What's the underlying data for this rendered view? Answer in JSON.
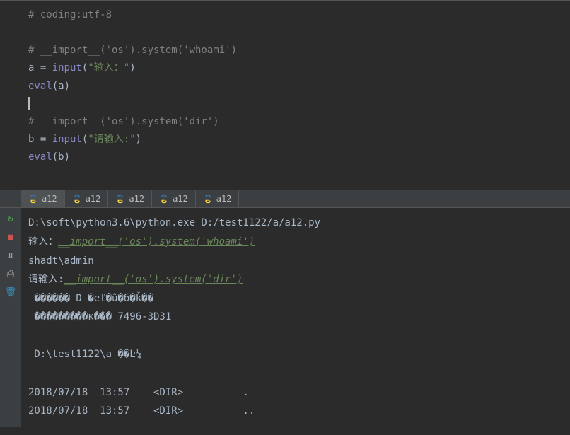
{
  "editor": {
    "lines": [
      {
        "type": "comment",
        "text": "# coding:utf-8"
      },
      {
        "type": "blank",
        "text": ""
      },
      {
        "type": "comment",
        "text": "# __import__('os').system('whoami')"
      },
      {
        "type": "assign",
        "var": "a",
        "op": " = ",
        "func": "input",
        "string": "\"输入：\""
      },
      {
        "type": "call",
        "func": "eval",
        "arg": "a"
      },
      {
        "type": "caret",
        "text": ""
      },
      {
        "type": "comment",
        "text": "# __import__('os').system('dir')"
      },
      {
        "type": "assign",
        "var": "b",
        "op": " = ",
        "func": "input",
        "string": "\"请输入:\""
      },
      {
        "type": "call",
        "func": "eval",
        "arg": "b"
      },
      {
        "type": "blank",
        "text": ""
      }
    ]
  },
  "tabs": {
    "items": [
      {
        "label": "a12",
        "active": true
      },
      {
        "label": "a12",
        "active": false
      },
      {
        "label": "a12",
        "active": false
      },
      {
        "label": "a12",
        "active": false
      },
      {
        "label": "a12",
        "active": false
      }
    ]
  },
  "toolbar": {
    "icons": [
      "rerun-icon",
      "stop-icon",
      "down-icon",
      "print-icon",
      "trash-icon"
    ]
  },
  "console": {
    "lines": [
      {
        "kind": "plain",
        "text": "D:\\soft\\python3.6\\python.exe D:/test1122/a/a12.py"
      },
      {
        "kind": "prompt",
        "label": "输入：",
        "input": "__import__('os').system('whoami')"
      },
      {
        "kind": "plain",
        "text": "shadt\\admin"
      },
      {
        "kind": "prompt",
        "label": "请输入:",
        "input": "__import__('os').system('dir')"
      },
      {
        "kind": "plain",
        "text": " ������ D �еľ�û�б�ǩ��"
      },
      {
        "kind": "plain",
        "text": " ���������к��� 7496-3D31"
      },
      {
        "kind": "blank",
        "text": ""
      },
      {
        "kind": "plain",
        "text": " D:\\test1122\\a ��Ŀ¼"
      },
      {
        "kind": "blank",
        "text": ""
      },
      {
        "kind": "plain",
        "text": "2018/07/18  13:57    <DIR>          ."
      },
      {
        "kind": "plain",
        "text": "2018/07/18  13:57    <DIR>          .."
      }
    ]
  }
}
